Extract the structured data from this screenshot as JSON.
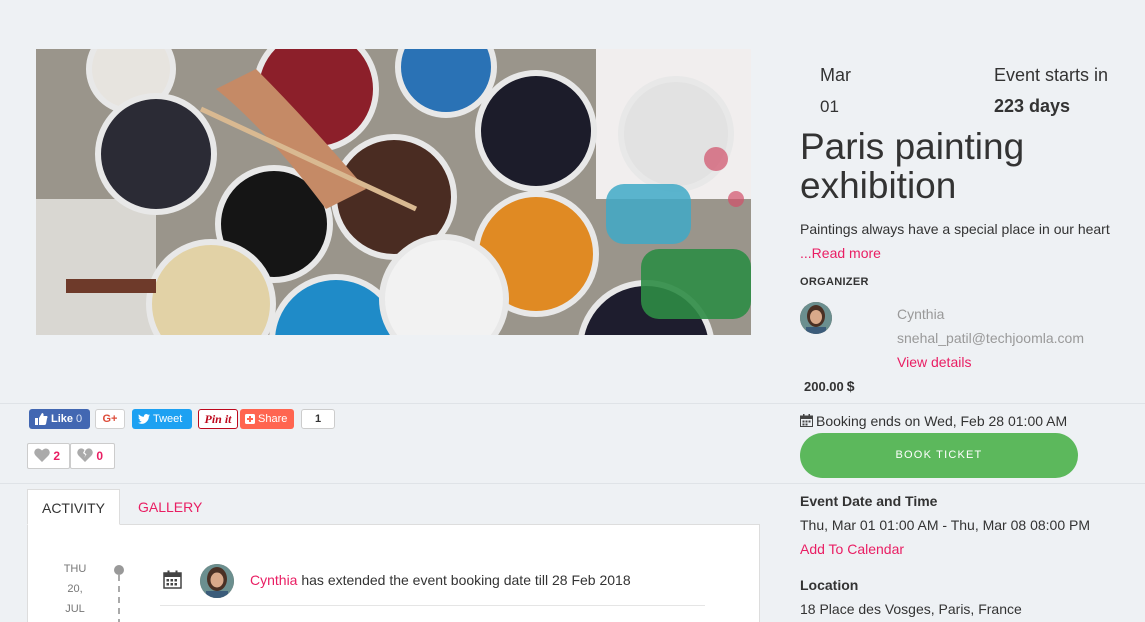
{
  "event": {
    "month": "Mar",
    "day": "01",
    "countdown_label": "Event starts in",
    "countdown_value": "223 days",
    "title": "Paris painting exhibition",
    "description": "Paintings always have a special place in our heart",
    "read_more": "...Read more"
  },
  "organizer": {
    "label": "ORGANIZER",
    "name": "Cynthia",
    "email": "snehal_patil@techjoomla.com",
    "details_link": "View details"
  },
  "price": {
    "amount": "200.00",
    "currency": "$"
  },
  "booking": {
    "ends_text": "Booking ends on Wed, Feb 28 01:00 AM",
    "button": "BOOK TICKET"
  },
  "schedule": {
    "heading": "Event Date and Time",
    "value": "Thu, Mar 01 01:00 AM - Thu, Mar 08 08:00 PM",
    "calendar_link": "Add To Calendar"
  },
  "location": {
    "heading": "Location",
    "value": "18 Place des Vosges, Paris, France"
  },
  "social": {
    "fb_label": "Like",
    "fb_count": "0",
    "gplus": "G+",
    "tweet": "Tweet",
    "pinit": "Pin it",
    "share": "Share",
    "share_count": "1"
  },
  "reactions": {
    "likes": "2",
    "dislikes": "0"
  },
  "tabs": [
    {
      "label": "ACTIVITY"
    },
    {
      "label": "GALLERY"
    }
  ],
  "activity": {
    "date_dow": "THU",
    "date_day": "20,",
    "date_month": "JUL",
    "actor": "Cynthia",
    "text": "has extended the event booking date till 28 Feb 2018"
  },
  "colors": {
    "accent": "#e91e63",
    "book_button": "#5cb85c",
    "facebook": "#4267b2",
    "twitter": "#1da1f2",
    "share": "#ff6550"
  }
}
